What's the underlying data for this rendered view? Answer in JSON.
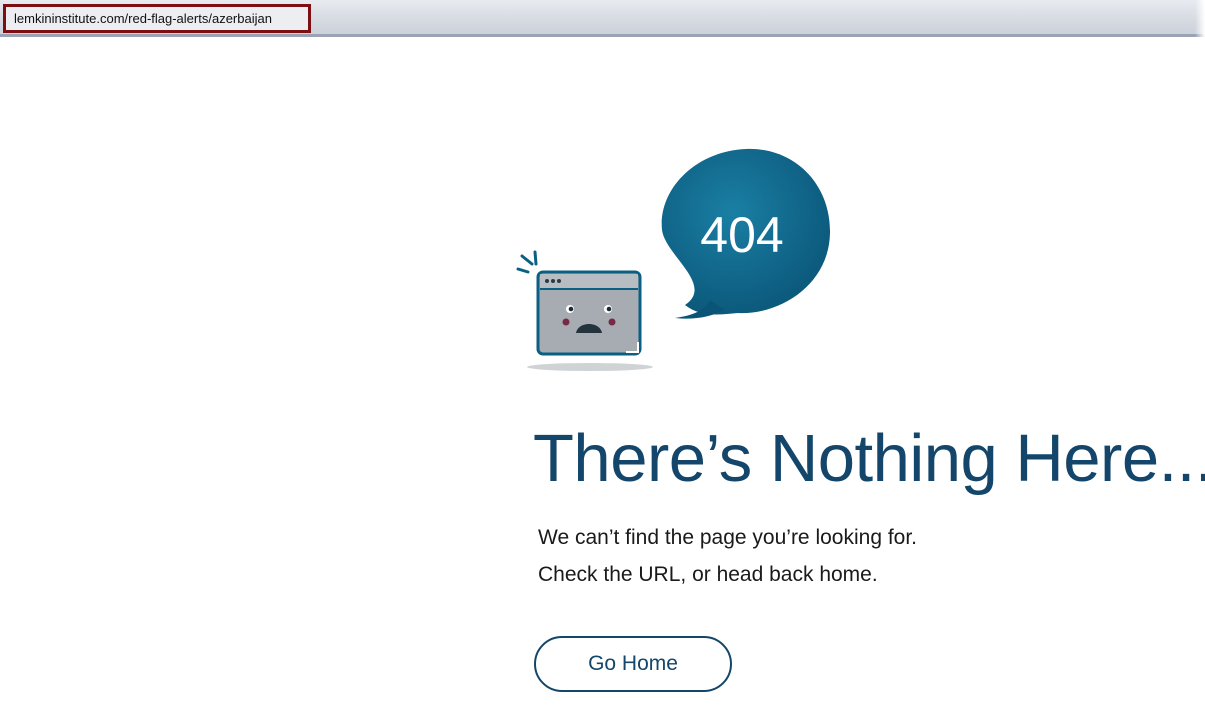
{
  "browser": {
    "url": "lemkininstitute.com/red-flag-alerts/azerbaijan"
  },
  "illustration": {
    "bubble_text": "404",
    "icon": "sad-browser-window-icon",
    "bubble_icon": "speech-bubble-icon"
  },
  "content": {
    "headline": "There’s Nothing Here...",
    "message_line_1": "We can’t find the page you’re looking for.",
    "message_line_2": "Check the URL, or head back home.",
    "go_home_label": "Go Home"
  },
  "colors": {
    "accent": "#13466a",
    "bubble": "#0e6485",
    "url_highlight": "#7d0e12"
  }
}
